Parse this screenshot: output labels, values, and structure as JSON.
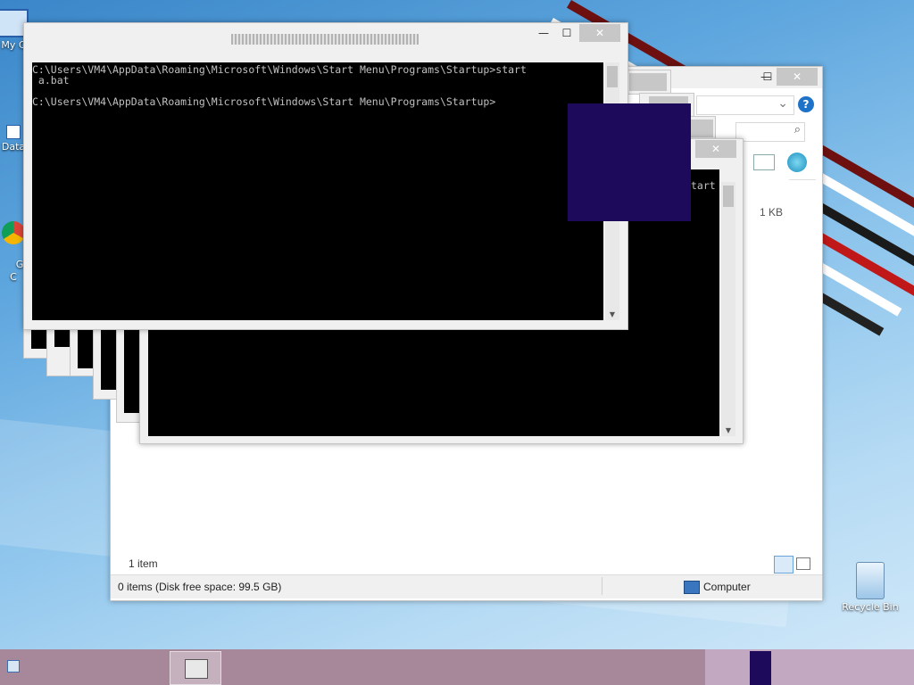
{
  "desktop_icons": [
    {
      "label": "My C",
      "icon": "computer-icon"
    },
    {
      "label": "Data",
      "icon": "shortcut-icon"
    },
    {
      "label": "G\nC",
      "icon": "chrome-icon"
    },
    {
      "label": "Recycle Bin",
      "icon": "recycle-bin-icon"
    }
  ],
  "cmd": {
    "title": "",
    "line1": "C:\\Users\\VM4\\AppData\\Roaming\\Microsoft\\Windows\\Start Menu\\Programs\\Startup>start",
    "line2": " a.bat",
    "line3": "C:\\Users\\VM4\\AppData\\Roaming\\Microsoft\\Windows\\Start Menu\\Programs\\Startup>"
  },
  "caption": {
    "minimize": "—",
    "maximize": "☐",
    "close": "✕"
  },
  "cmd_back": {
    "text": "tart"
  },
  "explorer": {
    "size_value": "1 KB",
    "items_count": "1 item",
    "status_left": "0 items (Disk free space: 99.5 GB)",
    "status_right": "Computer",
    "help": "?",
    "dropdown": "⌄",
    "search": "⌕"
  },
  "colors": {
    "overlay": "#1e0a5a",
    "close_gray": "#c7c7c7",
    "taskbar": "#a6889a"
  }
}
